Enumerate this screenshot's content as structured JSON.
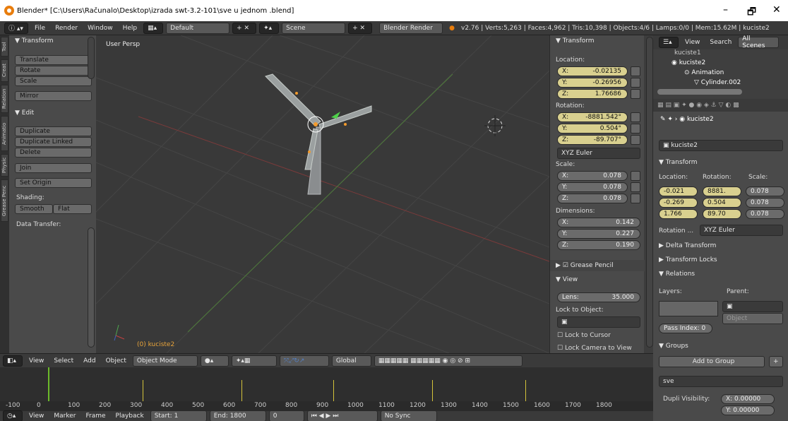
{
  "title_bar": {
    "text": "Blender* [C:\\Users\\Računalo\\Desktop\\izrada swt-3.2-101\\sve u jednom .blend]",
    "min": "–",
    "max": "🗗",
    "close": "✕"
  },
  "info_header": {
    "menus": [
      "File",
      "Render",
      "Window",
      "Help"
    ],
    "layout": "Default",
    "scene": "Scene",
    "engine": "Blender Render",
    "stats": "v2.76 | Verts:5,263 | Faces:4,962 | Tris:10,398 | Objects:4/6 | Lamps:0/0 | Mem:15.62M | kuciste2"
  },
  "tool_tabs": [
    "Tool",
    "Creat",
    "Relation",
    "Animatio",
    "Physic",
    "Grease Penc"
  ],
  "toolshelf": {
    "transform_header": "▼ Transform",
    "translate": "Translate",
    "rotate": "Rotate",
    "scale": "Scale",
    "mirror": "Mirror",
    "edit_header": "▼ Edit",
    "duplicate": "Duplicate",
    "duplicate_linked": "Duplicate Linked",
    "delete": "Delete",
    "join": "Join",
    "set_origin": "Set Origin",
    "shading": "Shading:",
    "smooth": "Smooth",
    "flat": "Flat",
    "data_transfer": "Data Transfer:"
  },
  "viewport": {
    "persp": "User Persp",
    "object_label": "(0) kuciste2"
  },
  "npanel": {
    "transform_header": "▼ Transform",
    "location": "Location:",
    "loc": [
      {
        "a": "X:",
        "v": "-0.02135"
      },
      {
        "a": "Y:",
        "v": "-0.26956"
      },
      {
        "a": "Z:",
        "v": "1.76686"
      }
    ],
    "rotation": "Rotation:",
    "rot": [
      {
        "a": "X:",
        "v": "-8881.542°"
      },
      {
        "a": "Y:",
        "v": "0.504°"
      },
      {
        "a": "Z:",
        "v": "-89.707°"
      }
    ],
    "rotation_mode": "XYZ Euler",
    "scale": "Scale:",
    "scl": [
      {
        "a": "X:",
        "v": "0.078"
      },
      {
        "a": "Y:",
        "v": "0.078"
      },
      {
        "a": "Z:",
        "v": "0.078"
      }
    ],
    "dimensions": "Dimensions:",
    "dim": [
      {
        "a": "X:",
        "v": "0.142"
      },
      {
        "a": "Y:",
        "v": "0.227"
      },
      {
        "a": "Z:",
        "v": "0.190"
      }
    ],
    "grease_pencil": "Grease Pencil",
    "view_header": "▼ View",
    "lens_label": "Lens:",
    "lens_value": "35.000",
    "lock_to_object": "Lock to Object:",
    "lock_to_cursor": "Lock to Cursor",
    "lock_camera": "Lock Camera to View"
  },
  "outliner": {
    "view": "View",
    "search": "Search",
    "all_scenes": "All Scenes",
    "items": [
      "kuciste1",
      "kuciste2",
      "Animation",
      "Cylinder.002"
    ]
  },
  "properties": {
    "object_name_crumb": "kuciste2",
    "object_name": "kuciste2",
    "transform_header": "▼ Transform",
    "location": "Location:",
    "rotation": "Rotation:",
    "scale": "Scale:",
    "loc": [
      "-0.021",
      "-0.269",
      "1.766"
    ],
    "rot": [
      "8881.",
      "0.504",
      "89.70"
    ],
    "scl": [
      "0.078",
      "0.078",
      "0.078"
    ],
    "rotation_mode_label": "Rotation ...",
    "rotation_mode": "XYZ Euler",
    "delta": "▶ Delta Transform",
    "locks": "▶ Transform Locks",
    "relations": "▼ Relations",
    "layers": "Layers:",
    "parent": "Parent:",
    "parent_type": "Object",
    "pass_index": "Pass Index: 0",
    "groups": "▼ Groups",
    "add_to_group": "Add to Group",
    "group_name": "sve",
    "dupli": "Dupli Visibility:",
    "dupli_x": "X: 0.00000",
    "dupli_y": "Y: 0.00000"
  },
  "view_header": {
    "menus": [
      "View",
      "Select",
      "Add",
      "Object"
    ],
    "mode": "Object Mode",
    "orientation": "Global"
  },
  "timeline": {
    "ruler": [
      "-100",
      "0",
      "100",
      "200",
      "300",
      "400",
      "500",
      "600",
      "700",
      "800",
      "900",
      "1000",
      "1100",
      "1200",
      "1300",
      "1400",
      "1500",
      "1600",
      "1700",
      "1800"
    ],
    "menus": [
      "View",
      "Marker",
      "Frame",
      "Playback"
    ],
    "start_label": "Start:",
    "start": "1",
    "end_label": "End:",
    "end": "1800",
    "current": "0",
    "sync": "No Sync"
  },
  "colors": {
    "accent": "#d9d08f",
    "selection": "#f39b2c",
    "active": "#5680c2"
  }
}
